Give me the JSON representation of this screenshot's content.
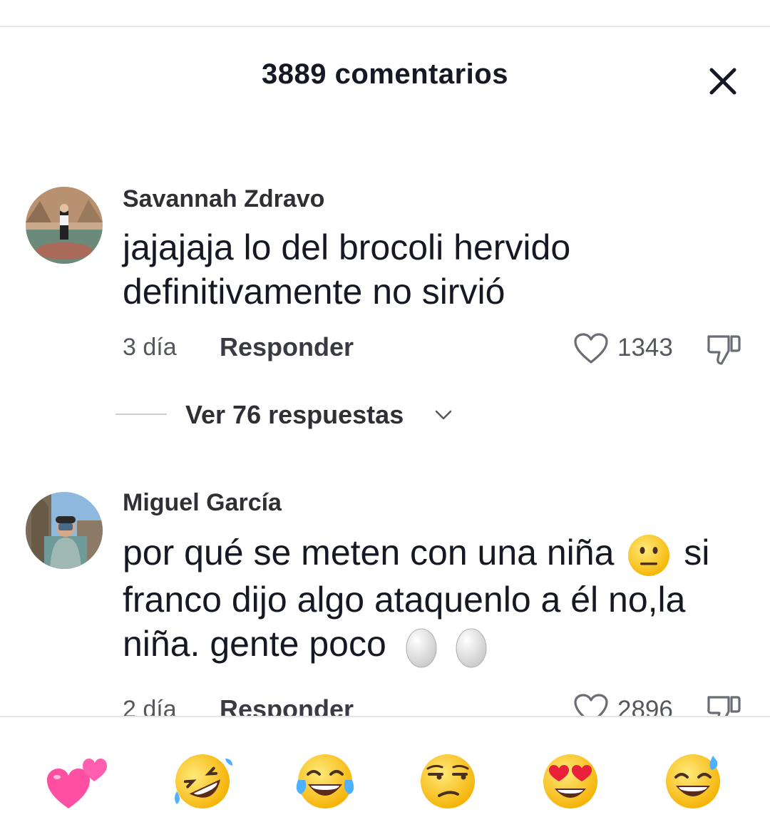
{
  "header": {
    "title": "3889 comentarios",
    "close_icon": "close-icon"
  },
  "comments": [
    {
      "username": "Savannah Zdravo",
      "text": "jajajaja lo del brocoli hervido definitivamente no sirvió",
      "age": "3 día",
      "reply_label": "Responder",
      "likes": "1343",
      "replies_label": "Ver 76 respuestas"
    },
    {
      "username": "Miguel García",
      "text_part1": "por qué se meten con una niña",
      "text_part2": "si franco dijo algo ataquenlo a él no,la niña. gente poco",
      "age": "2 día",
      "reply_label": "Responder",
      "likes": "2896"
    }
  ],
  "emoji_bar": [
    "two-hearts-emoji",
    "rolling-laughing-emoji",
    "tears-of-joy-emoji",
    "unamused-face-emoji",
    "heart-eyes-emoji",
    "sweat-smile-emoji"
  ],
  "colors": {
    "text": "#161823",
    "muted": "#55575e",
    "divider": "#e4e4e6"
  }
}
